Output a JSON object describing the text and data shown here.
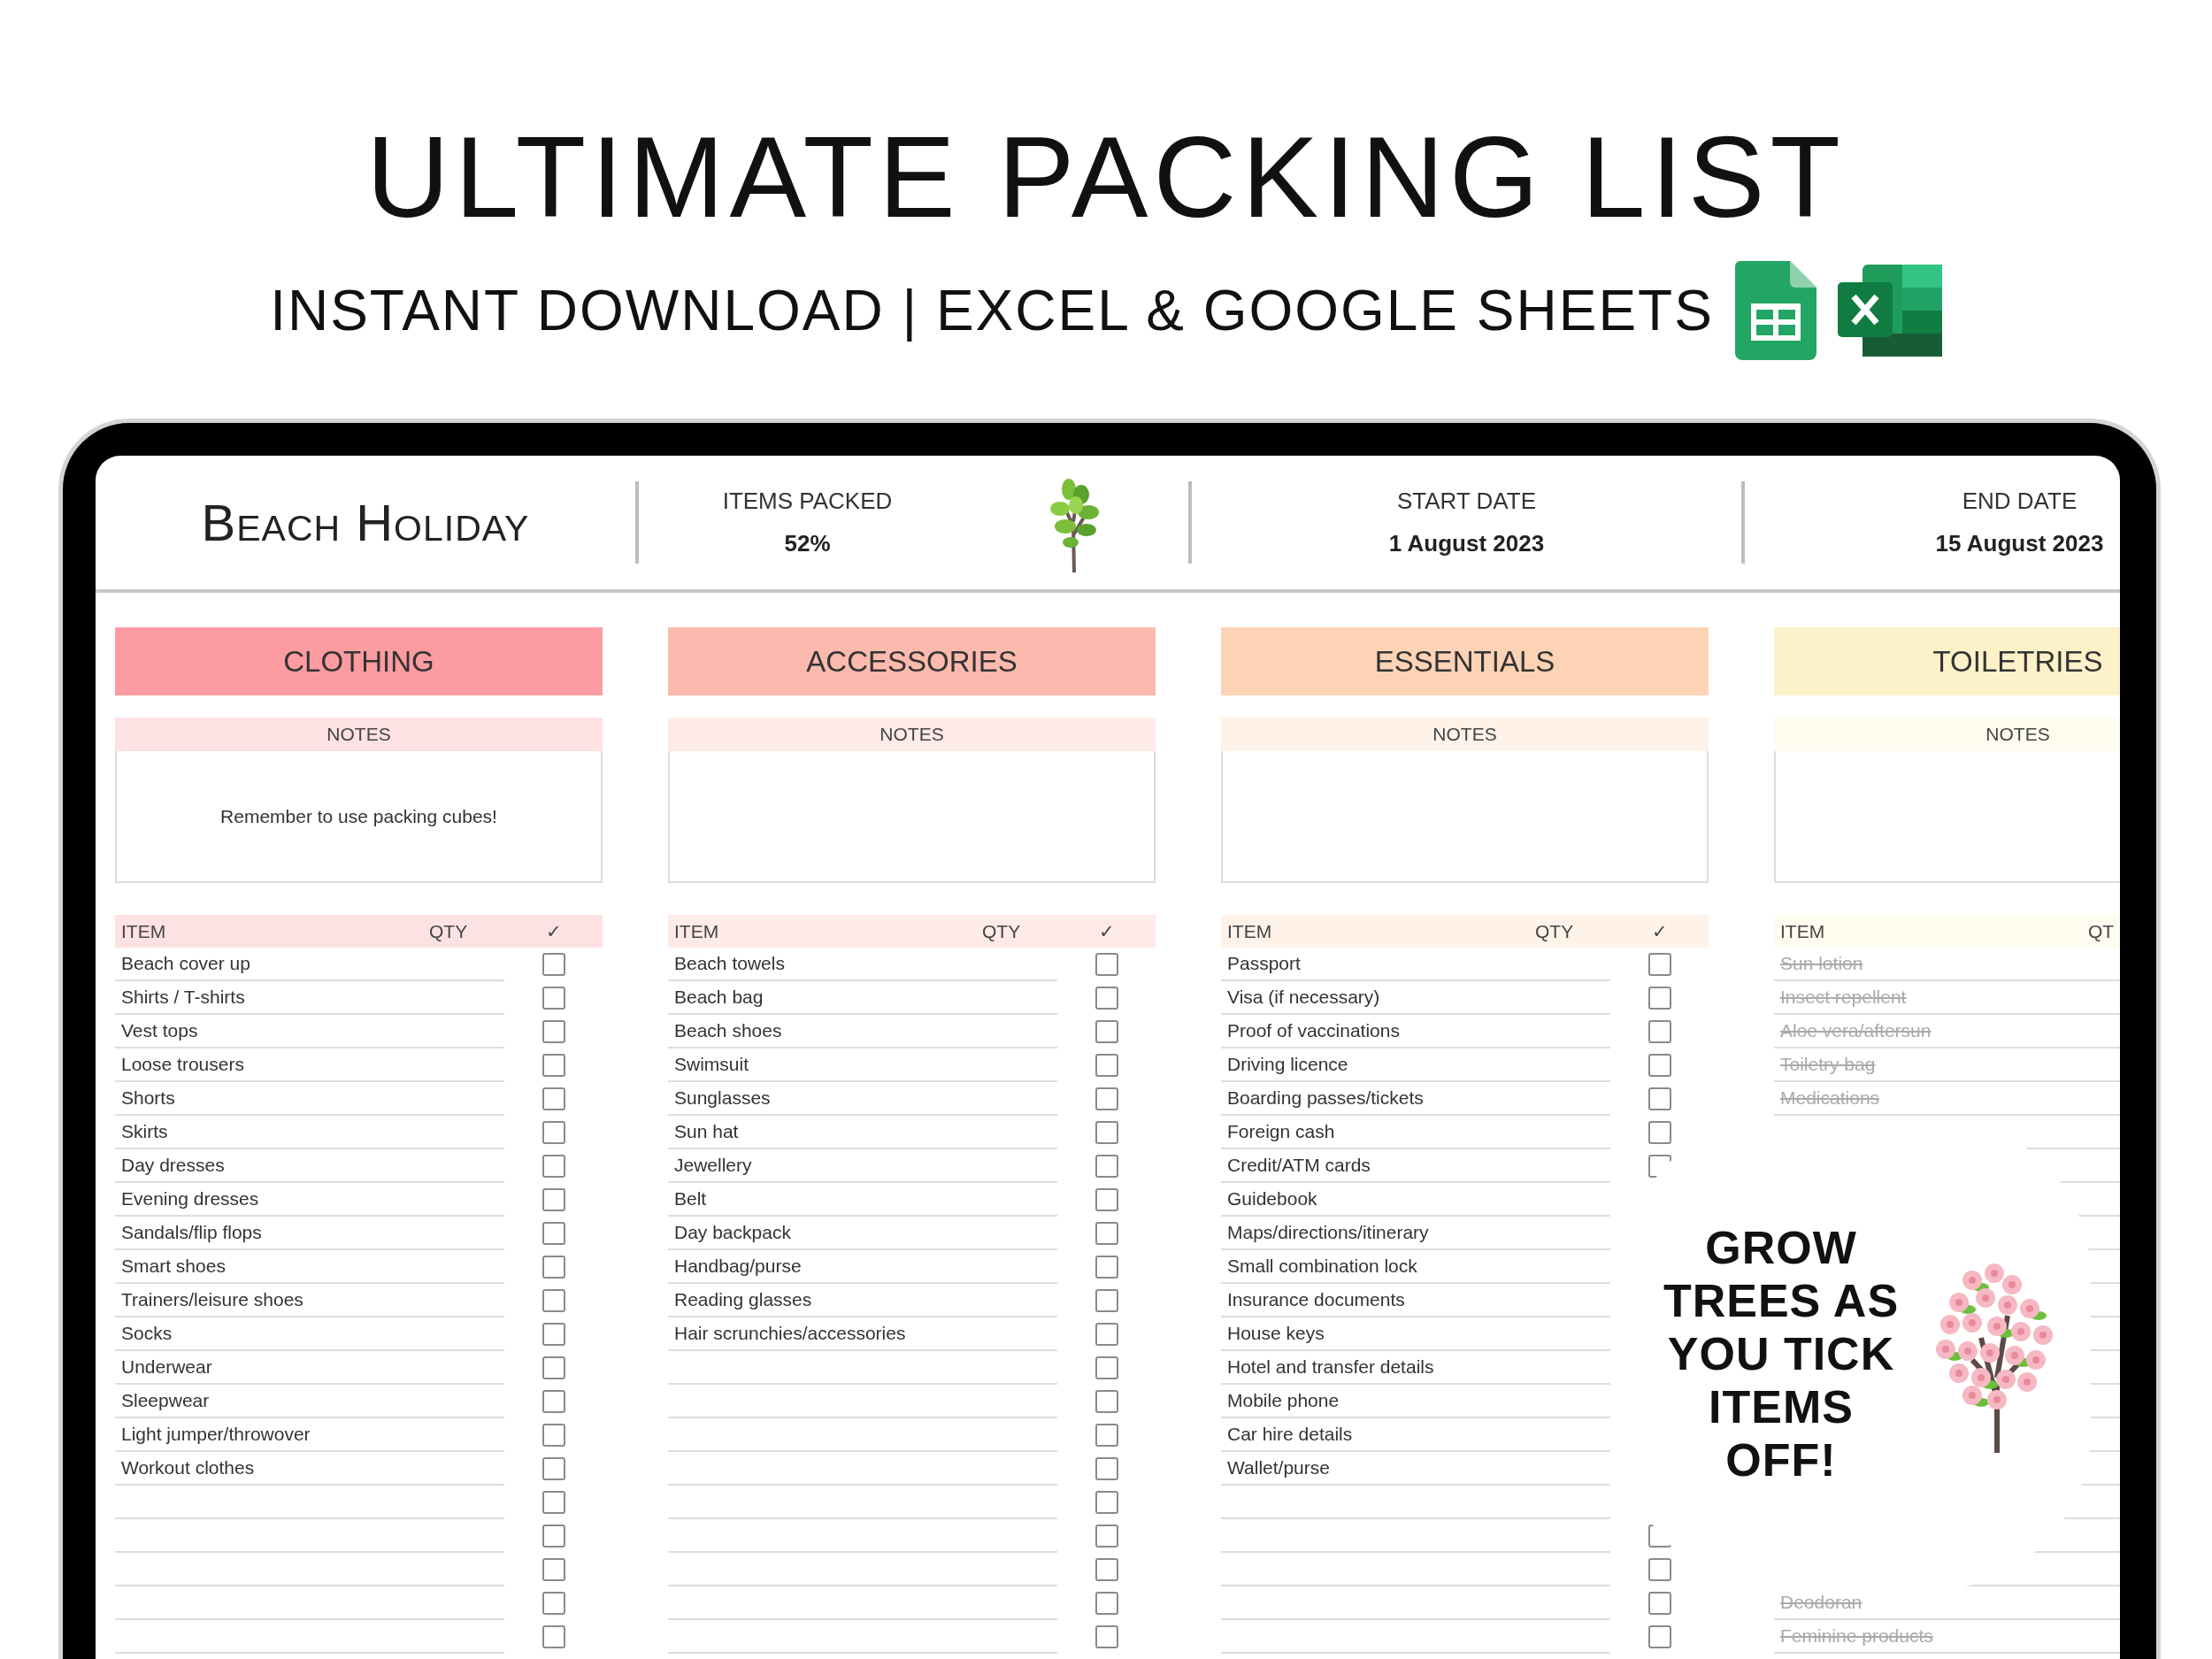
{
  "title": "ULTIMATE PACKING LIST",
  "subtitle": "INSTANT DOWNLOAD | EXCEL & GOOGLE SHEETS",
  "sheet": {
    "trip_name": "Beach Holiday",
    "stats": [
      {
        "label": "ITEMS PACKED",
        "value": "52%"
      },
      {
        "label": "START DATE",
        "value": "1 August 2023"
      },
      {
        "label": "END DATE",
        "value": "15 August 2023"
      }
    ],
    "categories": [
      {
        "name": "CLOTHING",
        "color": "#fc9ca1",
        "notes_label": "NOTES",
        "notes": "Remember to use packing cubes!",
        "columns": {
          "item": "ITEM",
          "qty": "QTY",
          "check": "✓"
        },
        "items": [
          {
            "text": "Beach cover up",
            "checked": false
          },
          {
            "text": "Shirts / T-shirts",
            "checked": false
          },
          {
            "text": "Vest tops",
            "checked": false
          },
          {
            "text": "Loose trousers",
            "checked": false
          },
          {
            "text": "Shorts",
            "checked": false
          },
          {
            "text": "Skirts",
            "checked": false
          },
          {
            "text": "Day dresses",
            "checked": false
          },
          {
            "text": "Evening dresses",
            "checked": false
          },
          {
            "text": "Sandals/flip flops",
            "checked": false
          },
          {
            "text": "Smart shoes",
            "checked": false
          },
          {
            "text": "Trainers/leisure shoes",
            "checked": false
          },
          {
            "text": "Socks",
            "checked": false
          },
          {
            "text": "Underwear",
            "checked": false
          },
          {
            "text": "Sleepwear",
            "checked": false
          },
          {
            "text": "Light jumper/throwover",
            "checked": false
          },
          {
            "text": "Workout clothes",
            "checked": false
          },
          {
            "checked": false
          },
          {
            "checked": false
          },
          {
            "checked": false
          },
          {
            "checked": false
          },
          {
            "checked": false
          }
        ]
      },
      {
        "name": "ACCESSORIES",
        "color": "#fcb9ae",
        "notes_label": "NOTES",
        "columns": {
          "item": "ITEM",
          "qty": "QTY",
          "check": "✓"
        },
        "items": [
          {
            "text": "Beach towels",
            "checked": false
          },
          {
            "text": "Beach bag",
            "checked": false
          },
          {
            "text": "Beach shoes",
            "checked": false
          },
          {
            "text": "Swimsuit",
            "checked": false
          },
          {
            "text": "Sunglasses",
            "checked": false
          },
          {
            "text": "Sun hat",
            "checked": false
          },
          {
            "text": "Jewellery",
            "checked": false
          },
          {
            "text": "Belt",
            "checked": false
          },
          {
            "text": "Day backpack",
            "checked": false
          },
          {
            "text": "Handbag/purse",
            "checked": false
          },
          {
            "text": "Reading glasses",
            "checked": false
          },
          {
            "text": "Hair scrunchies/accessories",
            "checked": false
          },
          {
            "checked": false
          },
          {
            "checked": false
          },
          {
            "checked": false
          },
          {
            "checked": false
          },
          {
            "checked": false
          },
          {
            "checked": false
          },
          {
            "checked": false
          },
          {
            "checked": false
          },
          {
            "checked": false
          }
        ]
      },
      {
        "name": "ESSENTIALS",
        "color": "#fdd3b5",
        "notes_label": "NOTES",
        "columns": {
          "item": "ITEM",
          "qty": "QTY",
          "check": "✓"
        },
        "items": [
          {
            "text": "Passport",
            "checked": false
          },
          {
            "text": "Visa (if necessary)",
            "checked": false
          },
          {
            "text": "Proof of vaccinations",
            "checked": false
          },
          {
            "text": "Driving licence",
            "checked": false
          },
          {
            "text": "Boarding passes/tickets",
            "checked": false
          },
          {
            "text": "Foreign cash",
            "checked": false
          },
          {
            "text": "Credit/ATM cards",
            "checked": false
          },
          {
            "text": "Guidebook"
          },
          {
            "text": "Maps/directions/itinerary"
          },
          {
            "text": "Small combination lock"
          },
          {
            "text": "Insurance documents"
          },
          {
            "text": "House keys"
          },
          {
            "text": "Hotel and transfer details"
          },
          {
            "text": "Mobile phone"
          },
          {
            "text": "Car hire details"
          },
          {
            "text": "Wallet/purse"
          }
        ],
        "bottom_items": [
          {
            "checked": false
          },
          {
            "checked": false
          },
          {
            "checked": false
          },
          {
            "checked": false
          }
        ]
      },
      {
        "name": "TOILETRIES",
        "color": "#fdf1c9",
        "notes_label": "NOTES",
        "columns": {
          "item": "ITEM",
          "qty": "QT"
        },
        "items": [
          {
            "text": "Sun lotion",
            "checked": true
          },
          {
            "text": "Insect repellent",
            "checked": true
          },
          {
            "text": "Aloe vera/aftersun",
            "checked": true
          },
          {
            "text": "Toiletry bag",
            "checked": true
          },
          {
            "text": "Medications",
            "checked": true
          }
        ],
        "bottom_items": [
          {
            "text": "Deodoran",
            "checked": true
          },
          {
            "text": "Feminine products",
            "checked": true
          }
        ]
      }
    ]
  },
  "overlay": {
    "caption": "GROW TREES AS YOU TICK ITEMS OFF!"
  }
}
